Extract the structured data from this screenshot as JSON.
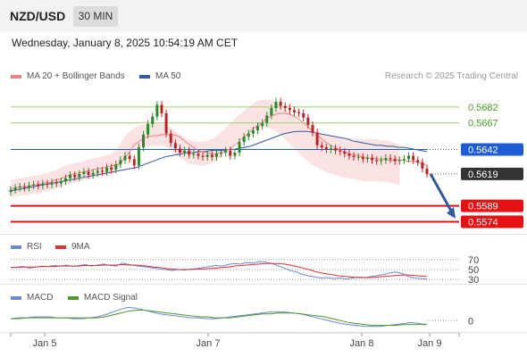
{
  "header": {
    "pair": "NZD/USD",
    "timeframe": "30 MIN"
  },
  "datetime": "Wednesday, January 8, 2025 10:54:19 AM CET",
  "legend": {
    "ma20": "MA 20 + Bollinger Bands",
    "ma50": "MA 50",
    "credit": "Research © 2025 Trading Central",
    "rsi": "RSI",
    "ma9": "9MA",
    "macd": "MACD",
    "macd_signal": "MACD Signal"
  },
  "colors": {
    "ma20": "#f08080",
    "ma50": "#2e5aa8",
    "band": "#fcdede",
    "green": "#9ccf6a",
    "blue": "#1e5cd6",
    "red": "#e81010",
    "current": "#333333",
    "rsi": "#6a8ad6",
    "ma9": "#e03030",
    "macd": "#6a8ad6",
    "signal": "#4a9a2a",
    "up": "#2a8a2a",
    "down": "#c02020"
  },
  "chart_data": [
    {
      "type": "candlestick",
      "panel": "price",
      "ylim": [
        0.5566,
        0.5702
      ],
      "x_labels": [
        "Jan 5",
        "Jan 7",
        "Jan 8",
        "Jan 9"
      ],
      "levels": [
        {
          "value": 0.5682,
          "label": "0.5682",
          "kind": "resistance"
        },
        {
          "value": 0.5667,
          "label": "0.5667",
          "kind": "resistance"
        },
        {
          "value": 0.5642,
          "label": "0.5642",
          "kind": "pivot"
        },
        {
          "value": 0.5619,
          "label": "0.5619",
          "kind": "current"
        },
        {
          "value": 0.5589,
          "label": "0.5589",
          "kind": "support"
        },
        {
          "value": 0.5574,
          "label": "0.5574",
          "kind": "support"
        }
      ],
      "close": [
        0.5604,
        0.5606,
        0.5607,
        0.5606,
        0.5608,
        0.5609,
        0.5608,
        0.561,
        0.5609,
        0.5611,
        0.561,
        0.5612,
        0.5615,
        0.5618,
        0.5616,
        0.5619,
        0.5621,
        0.5618,
        0.562,
        0.5622,
        0.5621,
        0.5625,
        0.5623,
        0.5628,
        0.5632,
        0.5636,
        0.5633,
        0.5627,
        0.5644,
        0.5656,
        0.5666,
        0.5673,
        0.5684,
        0.5676,
        0.5657,
        0.5648,
        0.5643,
        0.5639,
        0.5641,
        0.5637,
        0.5638,
        0.5636,
        0.5635,
        0.5637,
        0.5635,
        0.5638,
        0.5639,
        0.5641,
        0.5636,
        0.5639,
        0.5649,
        0.5654,
        0.5657,
        0.566,
        0.5664,
        0.5667,
        0.5674,
        0.5681,
        0.5687,
        0.5683,
        0.5681,
        0.5679,
        0.5677,
        0.5676,
        0.5672,
        0.5665,
        0.5658,
        0.5646,
        0.5644,
        0.5642,
        0.5643,
        0.5641,
        0.564,
        0.5638,
        0.5636,
        0.5635,
        0.5635,
        0.5633,
        0.5634,
        0.5632,
        0.5631,
        0.5632,
        0.5634,
        0.5633,
        0.5631,
        0.5632,
        0.5633,
        0.5636,
        0.5632,
        0.563,
        0.5624,
        0.5619
      ],
      "ma20": [
        0.5605,
        0.5606,
        0.5607,
        0.5607,
        0.5608,
        0.5609,
        0.5609,
        0.5611,
        0.5611,
        0.5613,
        0.5614,
        0.5616,
        0.5618,
        0.5619,
        0.562,
        0.5621,
        0.5622,
        0.5623,
        0.5624,
        0.5625,
        0.5626,
        0.5627,
        0.5628,
        0.5632,
        0.5638,
        0.5645,
        0.5649,
        0.5652,
        0.5654,
        0.5655,
        0.5655,
        0.5656,
        0.5656,
        0.5656,
        0.5655,
        0.5652,
        0.5648,
        0.5645,
        0.5642,
        0.564,
        0.5639,
        0.5638,
        0.5638,
        0.5639,
        0.5641,
        0.5643,
        0.5647,
        0.5651,
        0.5655,
        0.5659,
        0.5663,
        0.5666,
        0.567,
        0.5673,
        0.5675,
        0.5676,
        0.5676,
        0.5675,
        0.5673,
        0.567,
        0.5666,
        0.5662,
        0.5658,
        0.5654,
        0.565,
        0.5647,
        0.5644,
        0.5642,
        0.564,
        0.5638,
        0.5637,
        0.5636,
        0.5635,
        0.5634,
        0.5634,
        0.5633,
        0.5633,
        0.5632,
        0.5632,
        0.5632,
        0.5632,
        0.5631,
        0.5631,
        0.563,
        0.5629,
        0.5627
      ],
      "ma50": [
        0.5603,
        0.5604,
        0.5605,
        0.5606,
        0.5607,
        0.5608,
        0.5609,
        0.561,
        0.5611,
        0.5612,
        0.5613,
        0.5614,
        0.5615,
        0.5616,
        0.5617,
        0.5618,
        0.5619,
        0.562,
        0.5621,
        0.5622,
        0.5623,
        0.5624,
        0.5625,
        0.5627,
        0.5629,
        0.5631,
        0.5633,
        0.5635,
        0.5636,
        0.5637,
        0.5638,
        0.5639,
        0.5639,
        0.564,
        0.564,
        0.5641,
        0.5641,
        0.5641,
        0.5642,
        0.5642,
        0.5643,
        0.5644,
        0.5645,
        0.5647,
        0.5649,
        0.5651,
        0.5653,
        0.5655,
        0.5657,
        0.5658,
        0.5659,
        0.5659,
        0.5659,
        0.5658,
        0.5657,
        0.5656,
        0.5655,
        0.5654,
        0.5653,
        0.5652,
        0.565,
        0.5649,
        0.5648,
        0.5647,
        0.5646,
        0.5646,
        0.5645,
        0.5645,
        0.5644,
        0.5644,
        0.5643,
        0.5642,
        0.5641,
        0.564
      ]
    },
    {
      "type": "line",
      "panel": "rsi",
      "ylim": [
        25,
        75
      ],
      "ticks": [
        {
          "value": 70,
          "label": "70"
        },
        {
          "value": 50,
          "label": "50"
        },
        {
          "value": 30,
          "label": "30"
        }
      ],
      "series": [
        {
          "name": "RSI",
          "values": [
            54,
            55,
            56,
            53,
            55,
            57,
            56,
            58,
            57,
            59,
            56,
            58,
            60,
            57,
            59,
            61,
            58,
            57,
            63,
            60,
            58,
            56,
            55,
            53,
            51,
            50,
            48,
            50,
            49,
            51,
            52,
            54,
            56,
            58,
            57,
            60,
            62,
            61,
            64,
            63,
            66,
            65,
            62,
            58,
            53,
            48,
            45,
            40,
            37,
            35,
            33,
            34,
            32,
            33,
            31,
            33,
            35,
            34,
            36,
            38,
            40,
            43,
            45,
            42,
            36,
            33,
            32,
            31
          ]
        },
        {
          "name": "9MA",
          "values": [
            54,
            54,
            55,
            55,
            55,
            56,
            56,
            56,
            57,
            57,
            57,
            57,
            58,
            58,
            58,
            59,
            59,
            59,
            60,
            59,
            59,
            58,
            57,
            55,
            54,
            52,
            51,
            50,
            50,
            50,
            51,
            51,
            52,
            53,
            54,
            55,
            57,
            58,
            59,
            60,
            61,
            62,
            62,
            62,
            61,
            59,
            56,
            53,
            50,
            46,
            43,
            41,
            39,
            37,
            36,
            35,
            34,
            34,
            34,
            35,
            36,
            37,
            38,
            39,
            39,
            38,
            37,
            36
          ]
        }
      ]
    },
    {
      "type": "line",
      "panel": "macd",
      "ylim": [
        -0.001,
        0.0018
      ],
      "ticks": [
        {
          "value": 0,
          "label": "0"
        }
      ],
      "series": [
        {
          "name": "MACD",
          "values": [
            0.0002,
            0.0003,
            0.0003,
            0.0004,
            0.0004,
            0.0004,
            0.0003,
            0.0003,
            0.0002,
            0.0002,
            0.0003,
            0.0004,
            0.0006,
            0.0009,
            0.0012,
            0.0014,
            0.0013,
            0.0011,
            0.0009,
            0.0007,
            0.0006,
            0.0005,
            0.0004,
            0.0003,
            0.0003,
            0.0002,
            0.0002,
            0.0003,
            0.0004,
            0.0005,
            0.0006,
            0.0007,
            0.0008,
            0.0009,
            0.0009,
            0.0009,
            0.0008,
            0.0007,
            0.0005,
            0.0003,
            0.0001,
            -0.0001,
            -0.0003,
            -0.0004,
            -0.0005,
            -0.0006,
            -0.0006,
            -0.0006,
            -0.0005,
            -0.0004,
            -0.0003,
            -0.0002,
            -0.0003,
            -0.0004
          ]
        },
        {
          "name": "MACD Signal",
          "values": [
            0.0002,
            0.0002,
            0.0003,
            0.0003,
            0.0003,
            0.0003,
            0.0003,
            0.0003,
            0.0003,
            0.0003,
            0.0003,
            0.0003,
            0.0004,
            0.0006,
            0.0008,
            0.001,
            0.0011,
            0.0011,
            0.001,
            0.0009,
            0.0008,
            0.0007,
            0.0006,
            0.0005,
            0.0004,
            0.0004,
            0.0003,
            0.0003,
            0.0003,
            0.0004,
            0.0005,
            0.0006,
            0.0007,
            0.0007,
            0.0008,
            0.0008,
            0.0008,
            0.0007,
            0.0006,
            0.0005,
            0.0004,
            0.0002,
            0.0,
            -0.0002,
            -0.0003,
            -0.0004,
            -0.0005,
            -0.0005,
            -0.0005,
            -0.0005,
            -0.0004,
            -0.0004,
            -0.0004,
            -0.0004
          ]
        }
      ]
    }
  ]
}
